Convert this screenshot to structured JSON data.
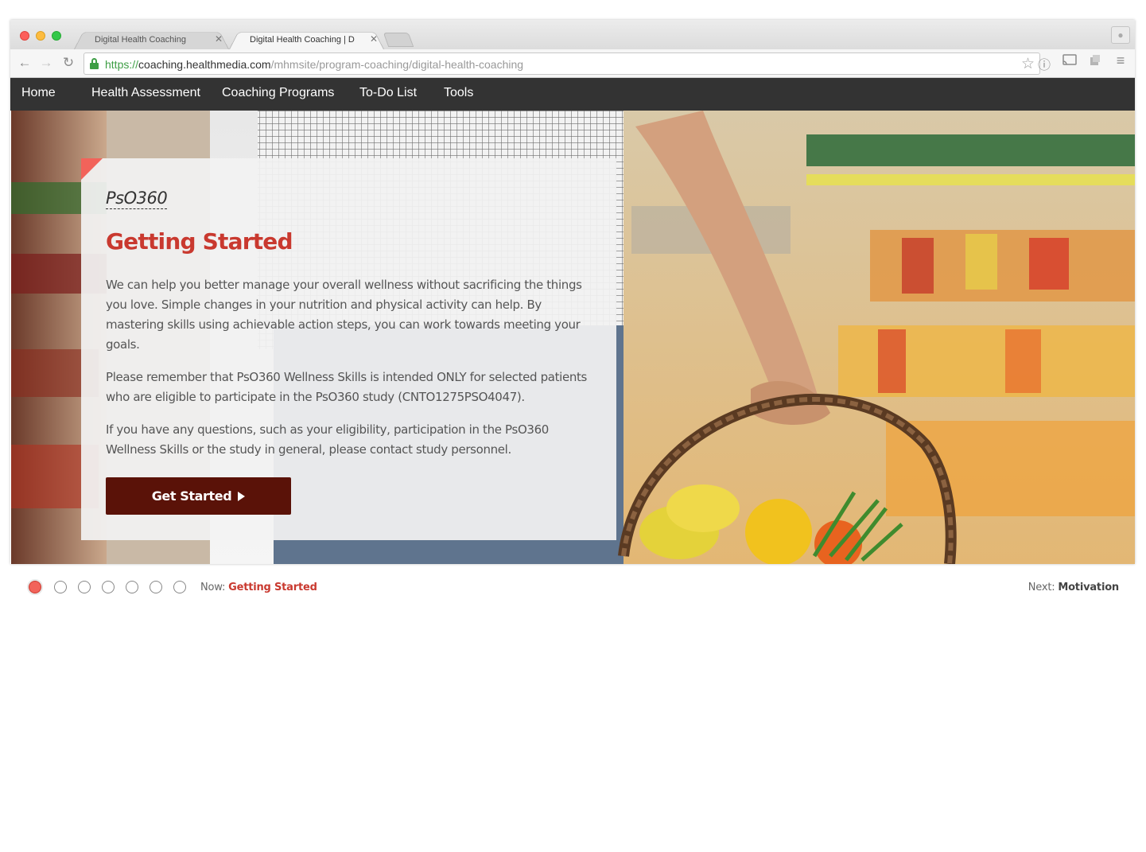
{
  "browser": {
    "tabs": [
      {
        "title": "Digital Health Coaching",
        "active": false
      },
      {
        "title": "Digital Health Coaching | D",
        "active": true
      }
    ],
    "url": {
      "scheme": "https://",
      "host": "coaching.healthmedia.com",
      "path": "/mhmsite/program-coaching/digital-health-coaching"
    },
    "icons": {
      "back": "arrow-left-icon",
      "forward": "arrow-right-icon",
      "reload": "reload-icon",
      "lock": "lock-icon",
      "bookmark": "star-icon",
      "info": "info-icon",
      "cast": "cast-icon",
      "extension": "extension-icon",
      "menu": "hamburger-menu-icon",
      "profile": "profile-icon"
    }
  },
  "site_nav": {
    "items": [
      "Home",
      "Health Assessment",
      "Coaching Programs",
      "To-Do List",
      "Tools"
    ]
  },
  "card": {
    "program_name": "PsO360",
    "title": "Getting Started",
    "paragraphs": [
      "We can help you better manage your overall wellness without sacrificing the things you love. Simple changes in your nutrition and physical activity can help. By mastering skills using achievable action steps, you can work towards meeting your goals.",
      "Please remember that PsO360 Wellness Skills is intended ONLY for selected patients who are eligible to participate in the PsO360 study (CNTO1275PSO4047).",
      "If you have any questions, such as your eligibility, participation in the PsO360 Wellness Skills or the study in general, please contact study personnel."
    ],
    "button_label": "Get Started"
  },
  "progress": {
    "total_steps": 7,
    "current_step": 1,
    "now_label": "Now:",
    "now_value": "Getting Started",
    "next_label": "Next:",
    "next_value": "Motivation"
  },
  "colors": {
    "accent": "#c9392f",
    "corner": "#f2635a",
    "button": "#5a1208",
    "nav_bg": "#333333"
  }
}
